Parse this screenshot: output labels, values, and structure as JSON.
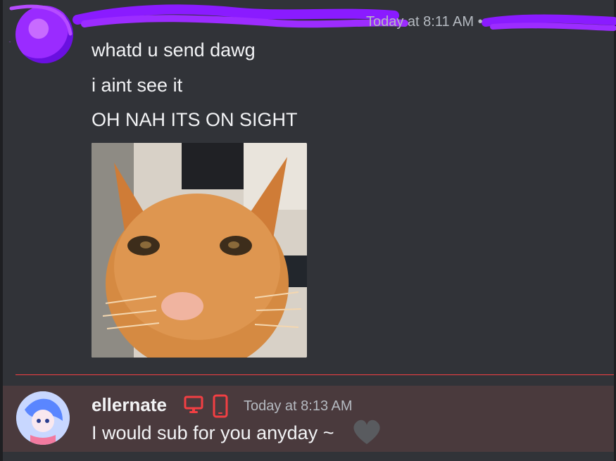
{
  "message1": {
    "timestamp": "Today at 8:11 AM •",
    "lines": [
      "whatd u send dawg",
      "i aint see it",
      "OH NAH ITS ON SIGHT"
    ],
    "attachment": {
      "icon": "orange-cat-image"
    }
  },
  "message2": {
    "username": "ellernate",
    "timestamp": "Today at 8:13 AM",
    "text": "I would sub for you anyday ~",
    "icons": [
      "desktop-icon",
      "mobile-icon",
      "heart-icon"
    ]
  },
  "colors": {
    "background": "#313338",
    "highlight": "#4a3a3d",
    "divider": "#f23f43",
    "status_red": "#f23f43",
    "redaction": "#8a1bff"
  }
}
